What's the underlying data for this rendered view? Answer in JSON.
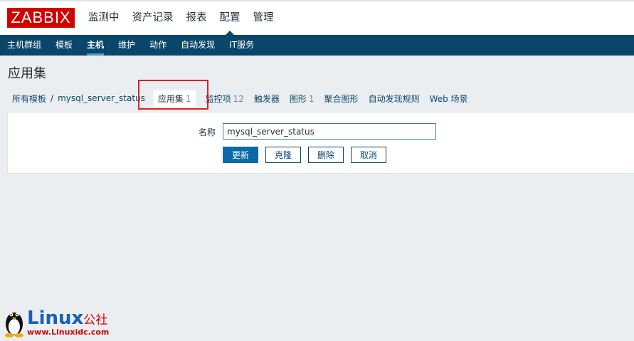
{
  "logo": {
    "text": "ZABBIX"
  },
  "main_nav": [
    {
      "label": "监测中"
    },
    {
      "label": "资产记录"
    },
    {
      "label": "报表"
    },
    {
      "label": "配置"
    },
    {
      "label": "管理"
    }
  ],
  "main_nav_selected": "配置",
  "sub_nav": [
    {
      "label": "主机群组"
    },
    {
      "label": "模板"
    },
    {
      "label": "主机"
    },
    {
      "label": "维护"
    },
    {
      "label": "动作"
    },
    {
      "label": "自动发现"
    },
    {
      "label": "IT服务"
    }
  ],
  "sub_nav_selected": "主机",
  "page_title": "应用集",
  "breadcrumb": {
    "all_templates": "所有模板",
    "separator": "/",
    "host": "mysql_server_status"
  },
  "tabs": {
    "applications": {
      "label": "应用集",
      "count": "1"
    },
    "items": {
      "label": "监控项",
      "count": "12"
    },
    "triggers": {
      "label": "触发器"
    },
    "graphs": {
      "label": "图形",
      "count": "1"
    },
    "screens": {
      "label": "聚合图形"
    },
    "discovery": {
      "label": "自动发现规则"
    },
    "web": {
      "label": "Web 场景"
    }
  },
  "form": {
    "name_label": "名称",
    "name_value": "mysql_server_status"
  },
  "buttons": {
    "update": "更新",
    "clone": "克隆",
    "delete": "删除",
    "cancel": "取消"
  },
  "watermark": {
    "brand": "Linux",
    "suffix": "公社",
    "url": "www.Linuxidc.com"
  },
  "colors": {
    "brand_red": "#d40000",
    "nav_dark": "#0a466a",
    "link": "#0a466a",
    "primary_button": "#0a6aa9",
    "highlight": "#e02020"
  }
}
